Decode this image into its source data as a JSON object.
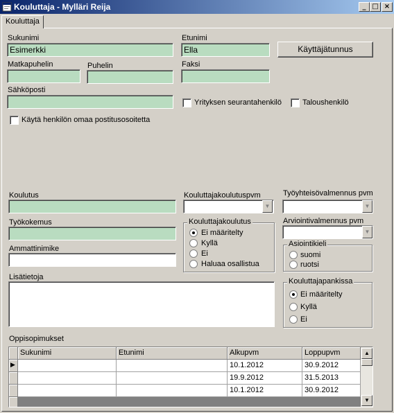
{
  "window": {
    "title": "Kouluttaja - Mylläri Reija",
    "minimize_glyph": "_",
    "maximize_glyph": "□",
    "close_glyph": "×"
  },
  "tabs": [
    {
      "label": "Kouluttaja"
    }
  ],
  "form": {
    "sukunimi": {
      "label": "Sukunimi",
      "value": "Esimerkki"
    },
    "etunimi": {
      "label": "Etunimi",
      "value": "Ella"
    },
    "kayttajatunnus_button": "Käyttäjätunnus",
    "matkapuhelin": {
      "label": "Matkapuhelin",
      "value": ""
    },
    "puhelin": {
      "label": "Puhelin",
      "value": ""
    },
    "faksi": {
      "label": "Faksi",
      "value": ""
    },
    "sahkoposti": {
      "label": "Sähköposti",
      "value": ""
    },
    "yrityksen_seurantahenkilo": {
      "label": "Yrityksen seurantahenkilö",
      "checked": false
    },
    "taloushenkilo": {
      "label": "Taloushenkilö",
      "checked": false
    },
    "kayta_postitusosoitetta": {
      "label": "Käytä henkilön omaa postitusosoitetta",
      "checked": false
    },
    "koulutus": {
      "label": "Koulutus",
      "value": ""
    },
    "kouluttajakoulutuspvm": {
      "label": "Kouluttajakoulutuspvm",
      "value": ""
    },
    "tyoyhteisovalmennus_pvm": {
      "label": "Työyhteisövalmennus pvm",
      "value": ""
    },
    "tyokokemus": {
      "label": "Työkokemus",
      "value": ""
    },
    "arviointivalmennus_pvm": {
      "label": "Arviointivalmennus pvm",
      "value": ""
    },
    "ammattinimike": {
      "label": "Ammattinimike",
      "value": ""
    },
    "lisatietoja": {
      "label": "Lisätietoja",
      "value": ""
    },
    "kouluttajakoulutus": {
      "title": "Kouluttajakoulutus",
      "options": [
        "Ei määritelty",
        "Kyllä",
        "Ei",
        "Haluaa osallistua"
      ],
      "selected": 0
    },
    "asiointikieli": {
      "title": "Asiointikieli",
      "options": [
        "suomi",
        "ruotsi"
      ],
      "selected": -1
    },
    "kouluttajapankissa": {
      "title": "Kouluttajapankissa",
      "options": [
        "Ei määritelty",
        "Kyllä",
        "Ei"
      ],
      "selected": 0
    }
  },
  "oppisopimukset": {
    "label": "Oppisopimukset",
    "columns": [
      "Sukunimi",
      "Etunimi",
      "Alkupvm",
      "Loppupvm"
    ],
    "rows": [
      [
        "",
        "",
        "10.1.2012",
        "30.9.2012"
      ],
      [
        "",
        "",
        "19.9.2012",
        "31.5.2013"
      ],
      [
        "",
        "",
        "10.1.2012",
        "30.9.2012"
      ]
    ],
    "current_row_glyph": "▶"
  },
  "icons": {
    "app": "app-icon",
    "dropdown": "▼",
    "scroll_up": "▲",
    "scroll_down": "▼"
  },
  "colors": {
    "titlebar_start": "#0a246a",
    "titlebar_end": "#a6caf0",
    "field_green": "#b9dcc0",
    "window_bg": "#d4d0c8"
  }
}
